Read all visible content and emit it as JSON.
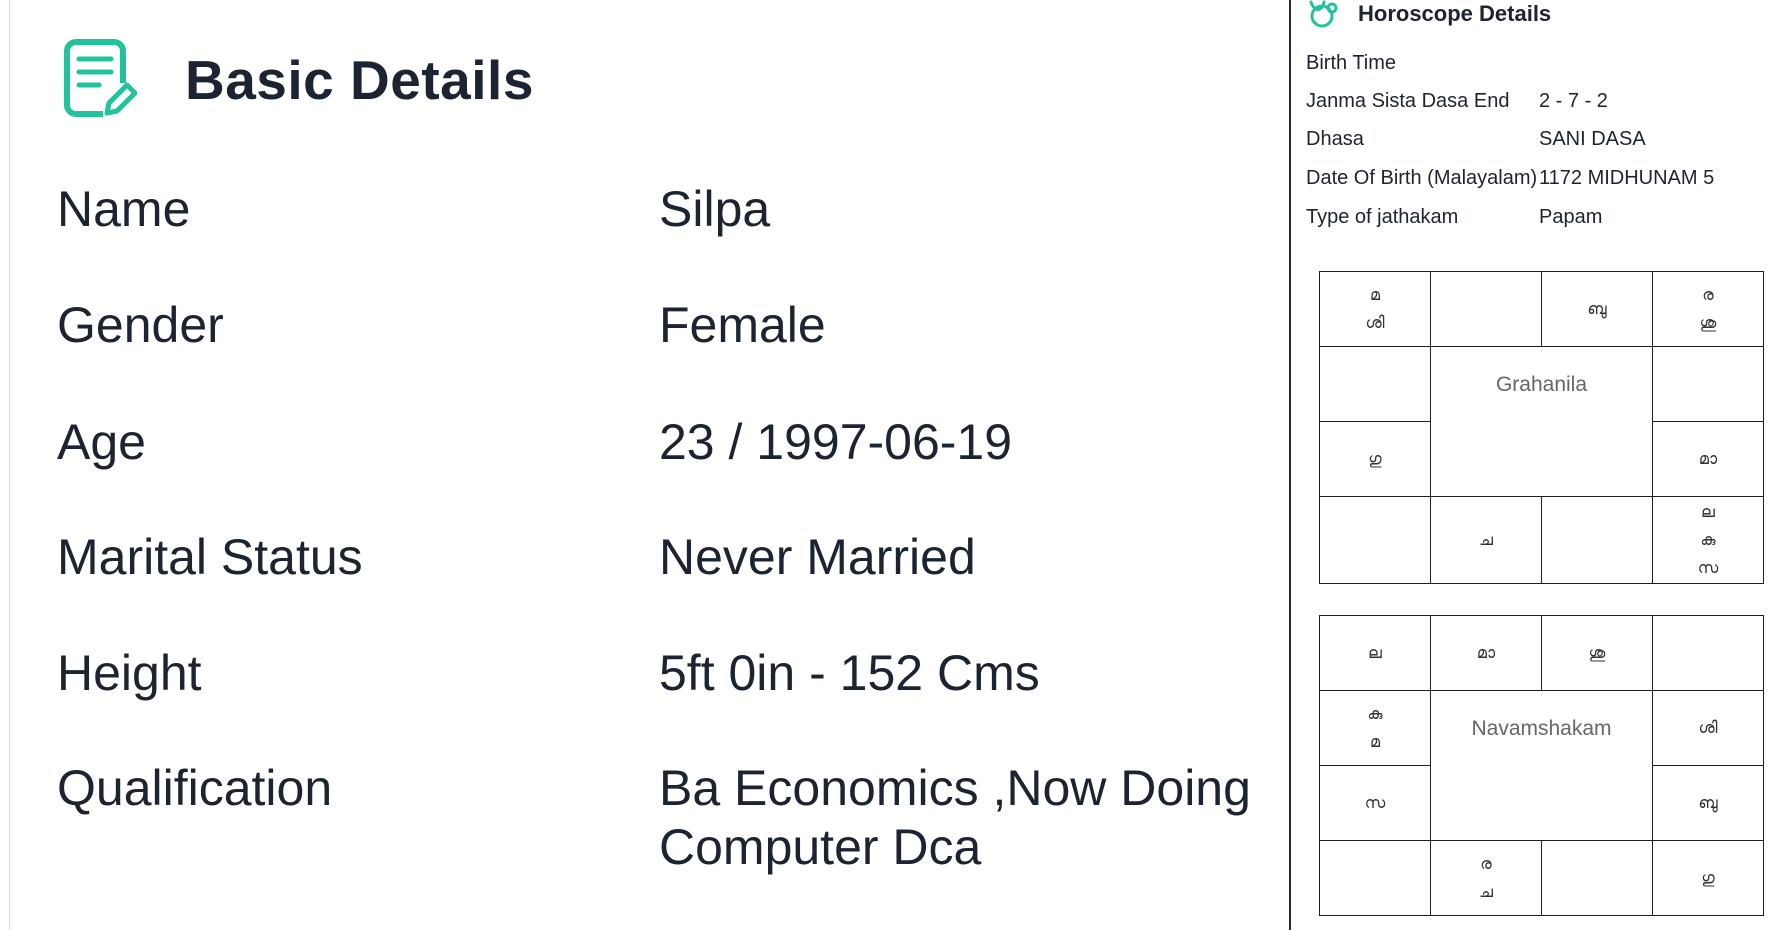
{
  "basic_details": {
    "title": "Basic Details",
    "icon": "form-edit-icon",
    "accent_color": "#22c39b",
    "rows": [
      {
        "label": "Name",
        "value": "Silpa"
      },
      {
        "label": "Gender",
        "value": "Female"
      },
      {
        "label": "Age",
        "value": "23 / 1997-06-19"
      },
      {
        "label": "Marital Status",
        "value": "Never Married"
      },
      {
        "label": "Height",
        "value": "5ft 0in - 152 Cms"
      },
      {
        "label": "Qualification",
        "value": "Ba Economics ,Now Doing Computer Dca"
      }
    ]
  },
  "horoscope": {
    "title": "Horoscope Details",
    "icon": "horoscope-icon",
    "rows": [
      {
        "label": "Birth Time",
        "value": ""
      },
      {
        "label": "Janma Sista Dasa End",
        "value": "2 - 7 - 2"
      },
      {
        "label": "Dhasa",
        "value": "SANI DASA"
      },
      {
        "label": "Date Of Birth (Malayalam)",
        "value": "1172 MIDHUNAM 5"
      },
      {
        "label": "Type of jathakam",
        "value": "Papam"
      }
    ],
    "grahanila": {
      "center_label": "Grahanila",
      "top": [
        [
          "മ",
          "ശി"
        ],
        [],
        [
          "ബു"
        ],
        [
          "ര",
          "ശു"
        ]
      ],
      "left": [
        [],
        [
          "ഗു"
        ]
      ],
      "right": [
        [],
        [
          "മാ"
        ]
      ],
      "bottom": [
        [],
        [
          "ച"
        ],
        [],
        [
          "ല",
          "കു",
          "സ"
        ]
      ]
    },
    "navamshakam": {
      "center_label": "Navamshakam",
      "top": [
        [
          "ല"
        ],
        [
          "മാ"
        ],
        [
          "ശു"
        ],
        []
      ],
      "left": [
        [
          "കു",
          "മ"
        ],
        [
          "സ"
        ]
      ],
      "right": [
        [
          "ശി"
        ],
        [
          "ബു"
        ]
      ],
      "bottom": [
        [],
        [
          "ര",
          "ച"
        ],
        [],
        [
          "ഗു"
        ]
      ]
    }
  }
}
